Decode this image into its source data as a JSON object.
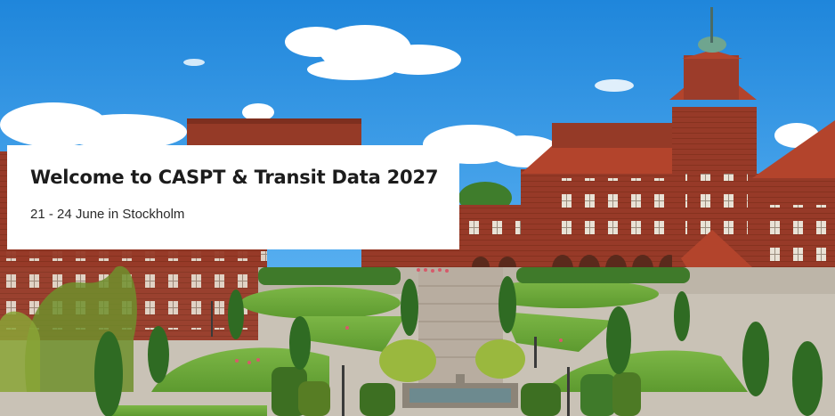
{
  "hero": {
    "title": "Welcome to CASPT & Transit Data 2027",
    "subtitle": "21 - 24 June in Stockholm",
    "image_description_colors": {
      "sky": "#2a8fe0",
      "brick": "#9c3c2a",
      "roof": "#b3442c",
      "grass": "#6ea93a",
      "tree": "#3f7a2a",
      "path": "#c9c2b6",
      "card_background": "#ffffff",
      "title_color": "#1c1c1c"
    }
  }
}
